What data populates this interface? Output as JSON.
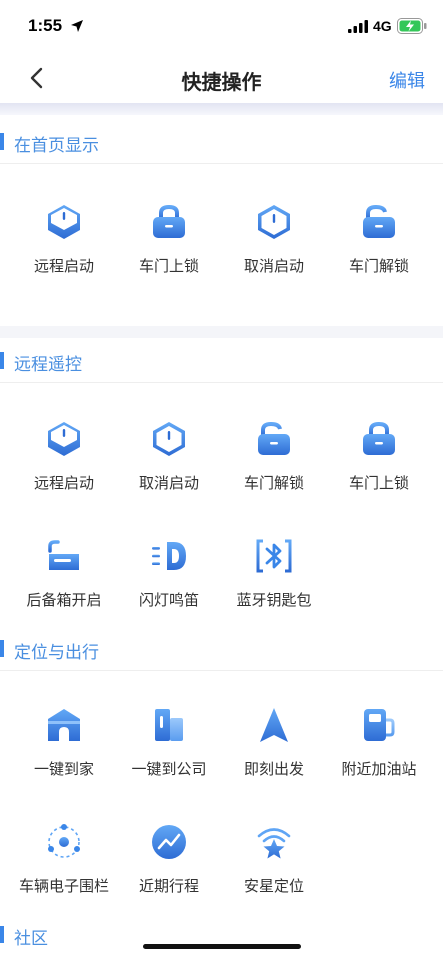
{
  "status_bar": {
    "time": "1:55",
    "network": "4G"
  },
  "nav": {
    "title": "快捷操作",
    "edit_label": "编辑"
  },
  "sections": {
    "home": {
      "title": "在首页显示",
      "items": [
        {
          "label": "远程启动",
          "icon": "remote-start"
        },
        {
          "label": "车门上锁",
          "icon": "door-lock"
        },
        {
          "label": "取消启动",
          "icon": "cancel-start"
        },
        {
          "label": "车门解锁",
          "icon": "door-unlock"
        }
      ]
    },
    "remote": {
      "title": "远程遥控",
      "items": [
        {
          "label": "远程启动",
          "icon": "remote-start"
        },
        {
          "label": "取消启动",
          "icon": "cancel-start"
        },
        {
          "label": "车门解锁",
          "icon": "door-unlock"
        },
        {
          "label": "车门上锁",
          "icon": "door-lock"
        },
        {
          "label": "后备箱开启",
          "icon": "trunk-open"
        },
        {
          "label": "闪灯鸣笛",
          "icon": "flash-horn"
        },
        {
          "label": "蓝牙钥匙包",
          "icon": "bluetooth-key"
        }
      ]
    },
    "travel": {
      "title": "定位与出行",
      "items": [
        {
          "label": "一键到家",
          "icon": "home"
        },
        {
          "label": "一键到公司",
          "icon": "office"
        },
        {
          "label": "即刻出发",
          "icon": "navigate"
        },
        {
          "label": "附近加油站",
          "icon": "gas-station"
        },
        {
          "label": "车辆电子围栏",
          "icon": "geofence"
        },
        {
          "label": "近期行程",
          "icon": "trips"
        },
        {
          "label": "安星定位",
          "icon": "star-location"
        }
      ]
    },
    "community": {
      "title": "社区"
    }
  },
  "colors": {
    "accent": "#3a86e8",
    "icon_dark": "#2f6fd6",
    "icon_light": "#5fa5f5",
    "section_bg": "#f4f5f9"
  }
}
